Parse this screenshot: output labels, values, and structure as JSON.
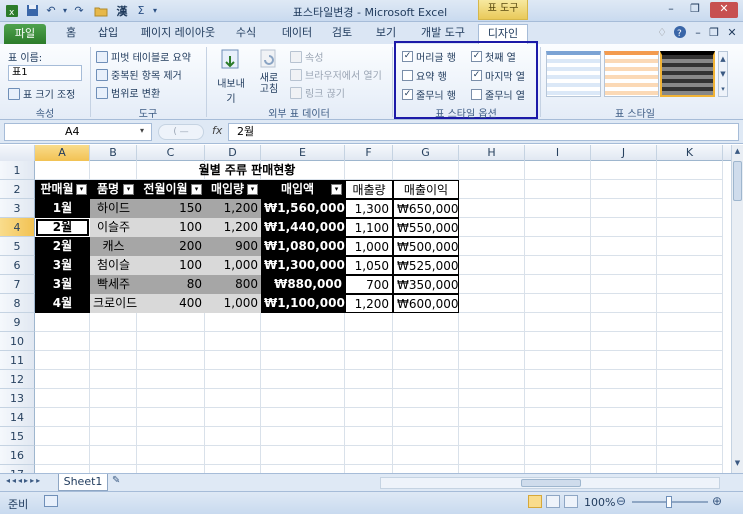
{
  "titlebar": {
    "title": "표스타일변경 - Microsoft Excel",
    "context_label": "표 도구",
    "quick_access": [
      "✓",
      "💾",
      "↶",
      "↷",
      "📂",
      "漢",
      "Σ",
      "▾"
    ]
  },
  "tabs": [
    "홈",
    "삽입",
    "페이지 레이아웃",
    "수식",
    "데이터",
    "검토",
    "보기",
    "개발 도구"
  ],
  "file_tab": "파일",
  "design_tab": "디자인",
  "ribbon": {
    "properties": {
      "table_name_label": "표 이름:",
      "table_name_value": "표1",
      "resize_label": "표 크기 조정",
      "group_label": "속성"
    },
    "tools": {
      "pivot": "피벗 테이블로 요약",
      "remove_dup": "중복된 항목 제거",
      "convert_range": "범위로 변환",
      "group_label": "도구"
    },
    "external": {
      "export": "내보내기",
      "refresh_line1": "새로",
      "refresh_line2": "고침",
      "properties": "속성",
      "open_browser": "브라우저에서 열기",
      "unlink": "링크 끊기",
      "group_label": "외부 표 데이터"
    },
    "style_options": {
      "header_row": "머리글 행",
      "total_row": "요약 행",
      "banded_rows": "줄무늬 행",
      "first_col": "첫째 열",
      "last_col": "마지막 열",
      "banded_cols": "줄무늬 열",
      "header_row_checked": "✓",
      "total_row_checked": "",
      "banded_rows_checked": "✓",
      "first_col_checked": "✓",
      "last_col_checked": "✓",
      "banded_cols_checked": "",
      "group_label": "표 스타일 옵션"
    },
    "styles": {
      "group_label": "표 스타일"
    }
  },
  "formula_bar": {
    "name_box": "A4",
    "fx": "fx",
    "formula": "2월"
  },
  "columns": [
    "A",
    "B",
    "C",
    "D",
    "E",
    "F",
    "G",
    "H",
    "I",
    "J",
    "K"
  ],
  "rows": [
    "1",
    "2",
    "3",
    "4",
    "5",
    "6",
    "7",
    "8",
    "9",
    "10",
    "11",
    "12",
    "13",
    "14",
    "15",
    "16",
    "17"
  ],
  "sheet": {
    "title": "월별 주류 판매현황",
    "headers": [
      "판매월",
      "품명",
      "전월이월",
      "매입량",
      "매입액",
      "매출량",
      "매출이익"
    ],
    "data": [
      [
        "1월",
        "하이드",
        "150",
        "1,200",
        "₩1,560,000",
        "1,300",
        "₩650,000"
      ],
      [
        "2월",
        "이슬주",
        "100",
        "1,200",
        "₩1,440,000",
        "1,100",
        "₩550,000"
      ],
      [
        "2월",
        "캐스",
        "200",
        "900",
        "₩1,080,000",
        "1,000",
        "₩500,000"
      ],
      [
        "3월",
        "첨이슬",
        "100",
        "1,000",
        "₩1,300,000",
        "1,050",
        "₩525,000"
      ],
      [
        "3월",
        "빡세주",
        "80",
        "800",
        "₩880,000",
        "700",
        "₩350,000"
      ],
      [
        "4월",
        "크로이드",
        "400",
        "1,000",
        "₩1,100,000",
        "1,200",
        "₩600,000"
      ]
    ]
  },
  "sheet_tabs": {
    "active": "Sheet1"
  },
  "status": {
    "ready": "준비",
    "zoom": "100%"
  },
  "colors": {
    "accent": "#1c1aa8",
    "file_tab": "#2c7c2a",
    "selected_header": "#f2c253"
  }
}
